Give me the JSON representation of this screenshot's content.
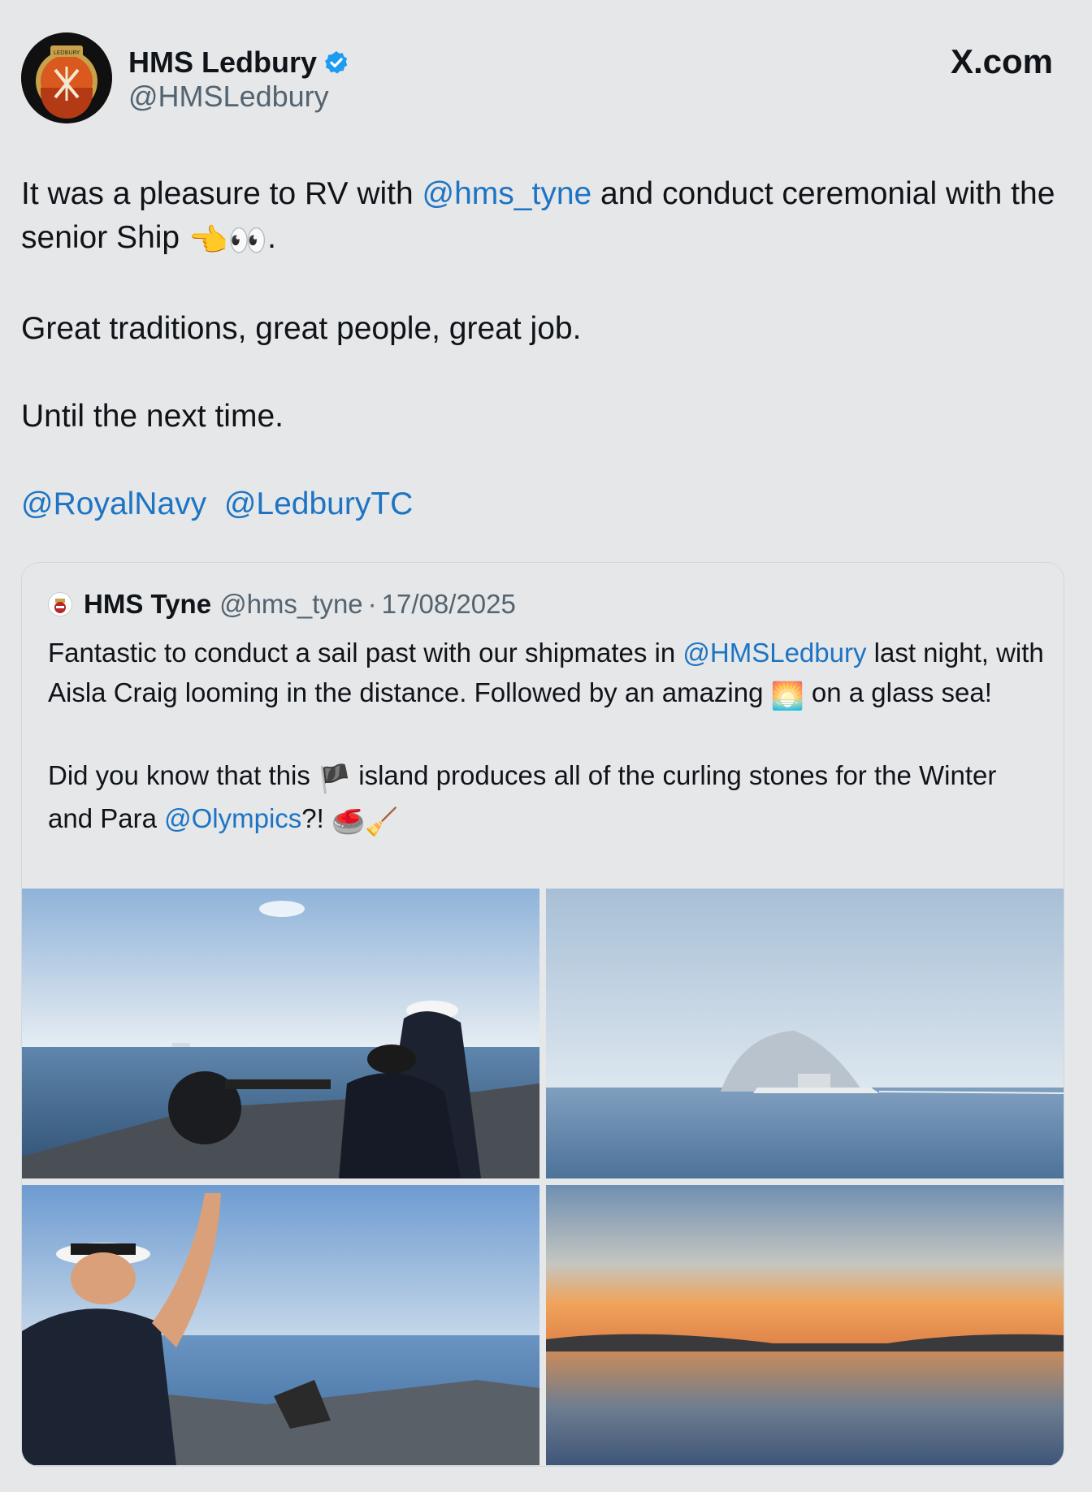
{
  "header": {
    "name": "HMS Ledbury",
    "handle": "@HMSLedbury",
    "site": "X.com",
    "badge_text": "LEDBURY"
  },
  "tweet": {
    "line1_a": "It was a pleasure to RV with ",
    "line1_link": "@hms_tyne",
    "line1_b": " and conduct ceremonial with the senior Ship ",
    "line1_emoji": "👈👀",
    "line1_end": ".",
    "para2": "Great traditions, great people, great job.",
    "para3": "Until the next time.",
    "mention1": "@RoyalNavy",
    "mention2": "@LedburyTC"
  },
  "quote": {
    "name": "HMS Tyne",
    "handle": "@hms_tyne",
    "separator": "·",
    "date": "17/08/2025",
    "p1_a": "Fantastic to conduct a sail past with our shipmates in ",
    "p1_link": "@HMSLedbury",
    "p1_b": " last night, with Aisla Craig looming in the distance. Followed by an amazing ",
    "p1_emoji": "🌅",
    "p1_c": " on a glass sea!",
    "p2_a": "Did you know that this ",
    "p2_emoji1": "🏴",
    "p2_b": " island produces all of the curling stones for the Winter and Para ",
    "p2_link": "@Olympics",
    "p2_c": "?! ",
    "p2_emoji2": "🥌🧹"
  },
  "images": [
    {
      "name": "photo-sailors-binoculars"
    },
    {
      "name": "photo-ailsa-craig-ship"
    },
    {
      "name": "photo-sailor-waving"
    },
    {
      "name": "photo-sunset-sea"
    }
  ]
}
